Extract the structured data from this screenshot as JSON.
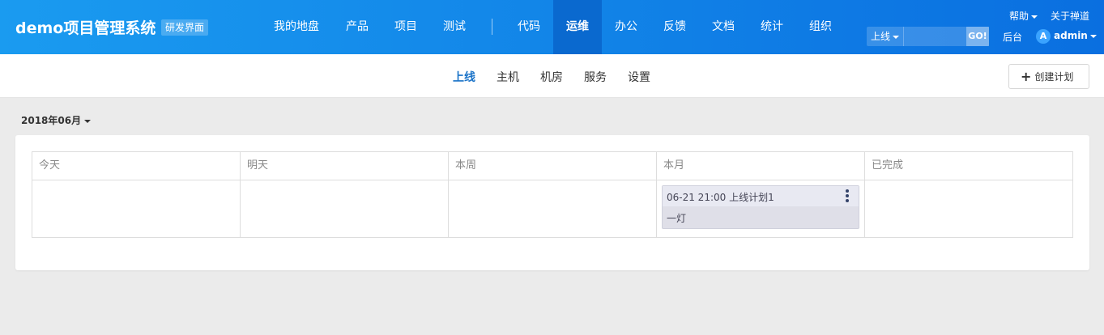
{
  "header": {
    "brand": "demo项目管理系统",
    "brand_tag": "研发界面",
    "nav": [
      "我的地盘",
      "产品",
      "项目",
      "测试",
      "代码",
      "运维",
      "办公",
      "反馈",
      "文档",
      "统计",
      "组织"
    ],
    "active_nav": "运维",
    "help": "帮助",
    "about": "关于禅道",
    "search_type": "上线",
    "search_placeholder": "",
    "search_go": "GO!",
    "backend": "后台",
    "avatar_letter": "A",
    "user": "admin"
  },
  "subnav": {
    "items": [
      "上线",
      "主机",
      "机房",
      "服务",
      "设置"
    ],
    "active": "上线",
    "create_label": "创建计划"
  },
  "month_selector": "2018年06月",
  "board": {
    "columns": [
      "今天",
      "明天",
      "本周",
      "本月",
      "已完成"
    ],
    "card": {
      "column": "本月",
      "title": "06-21 21:00 上线计划1",
      "desc": "一灯"
    }
  },
  "colors": {
    "header_from": "#1a9bf0",
    "header_to": "#0a6fe0",
    "active_nav_bg": "#0a69cf",
    "active_sub": "#1a73c8",
    "card_bg": "#dfdfe8"
  }
}
